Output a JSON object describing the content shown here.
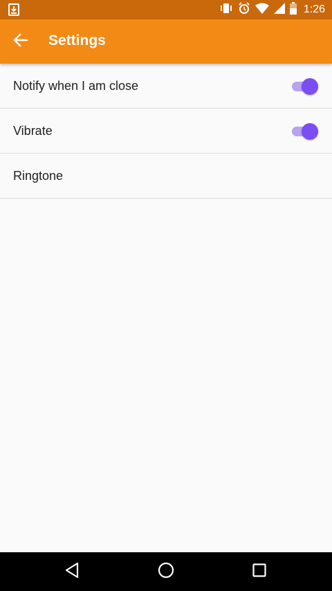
{
  "status_bar": {
    "time": "1:26",
    "icons": [
      "download-icon",
      "vibrate-icon",
      "alarm-icon",
      "wifi-icon",
      "signal-icon",
      "battery-icon"
    ]
  },
  "app_bar": {
    "title": "Settings",
    "back_icon": "arrow-back-icon"
  },
  "settings": [
    {
      "label": "Notify when I am close",
      "toggle": true
    },
    {
      "label": "Vibrate",
      "toggle": true
    },
    {
      "label": "Ringtone"
    }
  ],
  "nav_bar": {
    "icons": [
      "back-triangle-icon",
      "home-circle-icon",
      "recents-square-icon"
    ]
  },
  "colors": {
    "status_bar": "#C9690C",
    "app_bar": "#F28A15",
    "accent": "#7B4DF2",
    "background": "#FAFAFA"
  }
}
